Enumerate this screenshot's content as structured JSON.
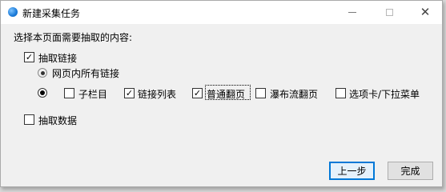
{
  "window": {
    "title": "新建采集任务"
  },
  "prompt": "选择本页面需要抽取的内容:",
  "extract_links": {
    "label": "抽取链接",
    "checked": true
  },
  "all_links_option": {
    "label": "网页内所有链接",
    "selected": false
  },
  "custom_option": {
    "selected": true
  },
  "options": {
    "subcolumn": {
      "label": "子栏目",
      "checked": false
    },
    "link_list": {
      "label": "链接列表",
      "checked": true
    },
    "normal_paging": {
      "label": "普通翻页",
      "checked": true
    },
    "waterfall_paging": {
      "label": "瀑布流翻页",
      "checked": false
    },
    "tab_dropdown": {
      "label": "选项卡/下拉菜单",
      "checked": false
    }
  },
  "extract_data": {
    "label": "抽取数据",
    "checked": false
  },
  "buttons": {
    "prev": "上一步",
    "finish": "完成"
  },
  "icons": {
    "app": "app-icon",
    "minimize": "minimize-icon",
    "maximize": "maximize-icon",
    "close": "close-icon",
    "check": "✓"
  }
}
